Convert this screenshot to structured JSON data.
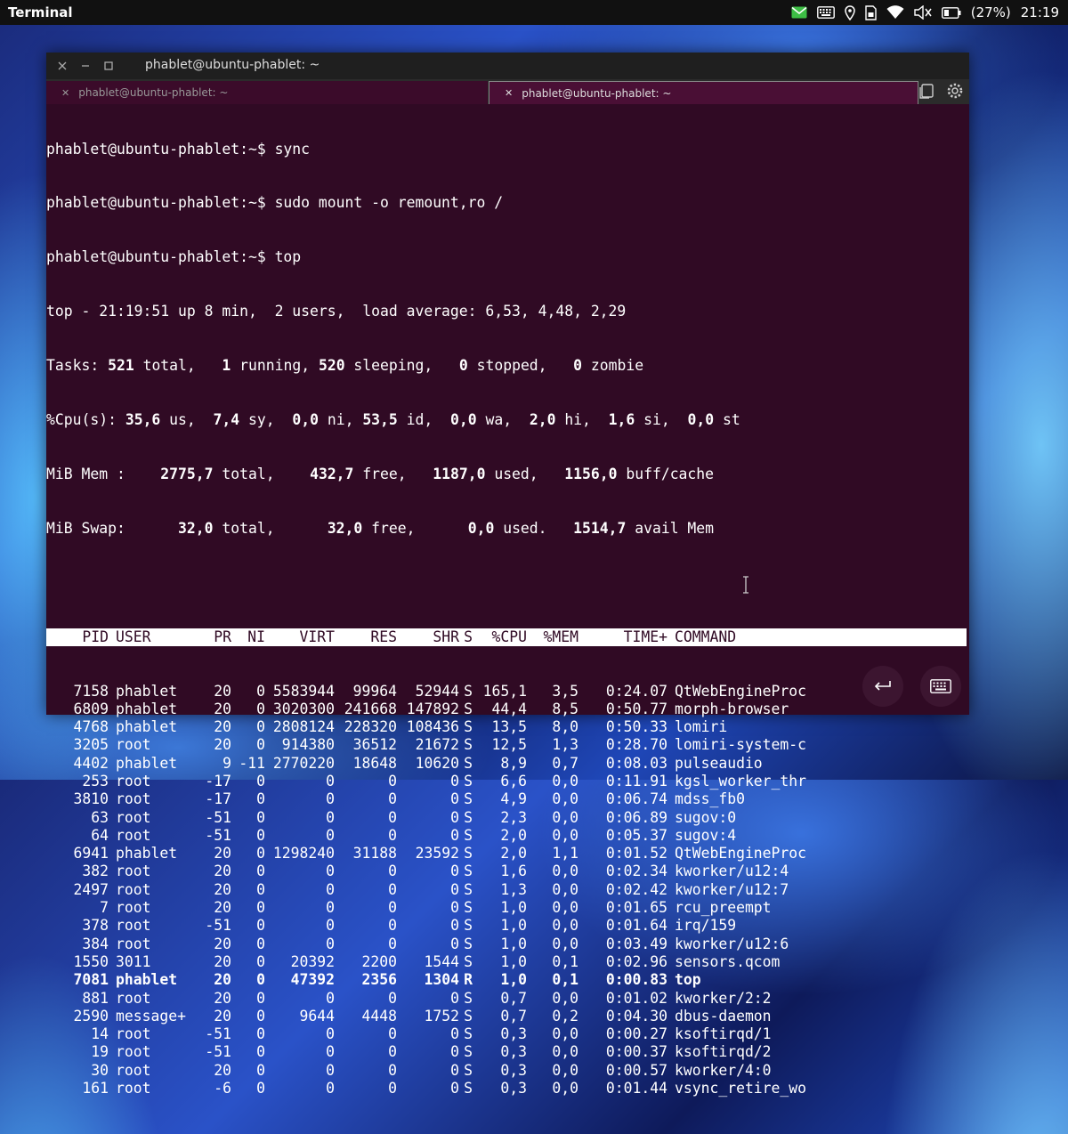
{
  "panel": {
    "title": "Terminal",
    "battery_pct": "(27%)",
    "time": "21:19"
  },
  "window": {
    "title": "phablet@ubuntu-phablet: ~",
    "tabs": [
      {
        "label": "phablet@ubuntu-phablet: ~",
        "active": false
      },
      {
        "label": "phablet@ubuntu-phablet: ~",
        "active": true
      }
    ]
  },
  "terminal": {
    "commands": [
      "phablet@ubuntu-phablet:~$ sync",
      "phablet@ubuntu-phablet:~$ sudo mount -o remount,ro /",
      "phablet@ubuntu-phablet:~$ top"
    ],
    "summary": {
      "uptime_line": "top - 21:19:51 up 8 min,  2 users,  load average: 6,53, 4,48, 2,29",
      "tasks": {
        "label": "Tasks:",
        "total": "521",
        "running": "1",
        "sleeping": "520",
        "stopped": "0",
        "zombie": "0"
      },
      "cpu": {
        "label": "%Cpu(s):",
        "us": "35,6",
        "sy": "7,4",
        "ni": "0,0",
        "id": "53,5",
        "wa": "0,0",
        "hi": "2,0",
        "si": "1,6",
        "st": "0,0"
      },
      "mem": {
        "label": "MiB Mem :",
        "total": "2775,7",
        "free": "432,7",
        "used": "1187,0",
        "buff": "1156,0"
      },
      "swap": {
        "label": "MiB Swap:",
        "total": "32,0",
        "free": "32,0",
        "used": "0,0",
        "avail": "1514,7"
      }
    },
    "columns": [
      "PID",
      "USER",
      "PR",
      "NI",
      "VIRT",
      "RES",
      "SHR",
      "S",
      "%CPU",
      "%MEM",
      "TIME+",
      "COMMAND"
    ],
    "processes": [
      {
        "pid": "7158",
        "user": "phablet",
        "pr": "20",
        "ni": "0",
        "virt": "5583944",
        "res": "99964",
        "shr": "52944",
        "s": "S",
        "cpu": "165,1",
        "mem": "3,5",
        "time": "0:24.07",
        "cmd": "QtWebEngineProc",
        "bold": false
      },
      {
        "pid": "6809",
        "user": "phablet",
        "pr": "20",
        "ni": "0",
        "virt": "3020300",
        "res": "241668",
        "shr": "147892",
        "s": "S",
        "cpu": "44,4",
        "mem": "8,5",
        "time": "0:50.77",
        "cmd": "morph-browser",
        "bold": false
      },
      {
        "pid": "4768",
        "user": "phablet",
        "pr": "20",
        "ni": "0",
        "virt": "2808124",
        "res": "228320",
        "shr": "108436",
        "s": "S",
        "cpu": "13,5",
        "mem": "8,0",
        "time": "0:50.33",
        "cmd": "lomiri",
        "bold": false
      },
      {
        "pid": "3205",
        "user": "root",
        "pr": "20",
        "ni": "0",
        "virt": "914380",
        "res": "36512",
        "shr": "21672",
        "s": "S",
        "cpu": "12,5",
        "mem": "1,3",
        "time": "0:28.70",
        "cmd": "lomiri-system-c",
        "bold": false
      },
      {
        "pid": "4402",
        "user": "phablet",
        "pr": "9",
        "ni": "-11",
        "virt": "2770220",
        "res": "18648",
        "shr": "10620",
        "s": "S",
        "cpu": "8,9",
        "mem": "0,7",
        "time": "0:08.03",
        "cmd": "pulseaudio",
        "bold": false
      },
      {
        "pid": "253",
        "user": "root",
        "pr": "-17",
        "ni": "0",
        "virt": "0",
        "res": "0",
        "shr": "0",
        "s": "S",
        "cpu": "6,6",
        "mem": "0,0",
        "time": "0:11.91",
        "cmd": "kgsl_worker_thr",
        "bold": false
      },
      {
        "pid": "3810",
        "user": "root",
        "pr": "-17",
        "ni": "0",
        "virt": "0",
        "res": "0",
        "shr": "0",
        "s": "S",
        "cpu": "4,9",
        "mem": "0,0",
        "time": "0:06.74",
        "cmd": "mdss_fb0",
        "bold": false
      },
      {
        "pid": "63",
        "user": "root",
        "pr": "-51",
        "ni": "0",
        "virt": "0",
        "res": "0",
        "shr": "0",
        "s": "S",
        "cpu": "2,3",
        "mem": "0,0",
        "time": "0:06.89",
        "cmd": "sugov:0",
        "bold": false
      },
      {
        "pid": "64",
        "user": "root",
        "pr": "-51",
        "ni": "0",
        "virt": "0",
        "res": "0",
        "shr": "0",
        "s": "S",
        "cpu": "2,0",
        "mem": "0,0",
        "time": "0:05.37",
        "cmd": "sugov:4",
        "bold": false
      },
      {
        "pid": "6941",
        "user": "phablet",
        "pr": "20",
        "ni": "0",
        "virt": "1298240",
        "res": "31188",
        "shr": "23592",
        "s": "S",
        "cpu": "2,0",
        "mem": "1,1",
        "time": "0:01.52",
        "cmd": "QtWebEngineProc",
        "bold": false
      },
      {
        "pid": "382",
        "user": "root",
        "pr": "20",
        "ni": "0",
        "virt": "0",
        "res": "0",
        "shr": "0",
        "s": "S",
        "cpu": "1,6",
        "mem": "0,0",
        "time": "0:02.34",
        "cmd": "kworker/u12:4",
        "bold": false
      },
      {
        "pid": "2497",
        "user": "root",
        "pr": "20",
        "ni": "0",
        "virt": "0",
        "res": "0",
        "shr": "0",
        "s": "S",
        "cpu": "1,3",
        "mem": "0,0",
        "time": "0:02.42",
        "cmd": "kworker/u12:7",
        "bold": false
      },
      {
        "pid": "7",
        "user": "root",
        "pr": "20",
        "ni": "0",
        "virt": "0",
        "res": "0",
        "shr": "0",
        "s": "S",
        "cpu": "1,0",
        "mem": "0,0",
        "time": "0:01.65",
        "cmd": "rcu_preempt",
        "bold": false
      },
      {
        "pid": "378",
        "user": "root",
        "pr": "-51",
        "ni": "0",
        "virt": "0",
        "res": "0",
        "shr": "0",
        "s": "S",
        "cpu": "1,0",
        "mem": "0,0",
        "time": "0:01.64",
        "cmd": "irq/159",
        "bold": false
      },
      {
        "pid": "384",
        "user": "root",
        "pr": "20",
        "ni": "0",
        "virt": "0",
        "res": "0",
        "shr": "0",
        "s": "S",
        "cpu": "1,0",
        "mem": "0,0",
        "time": "0:03.49",
        "cmd": "kworker/u12:6",
        "bold": false
      },
      {
        "pid": "1550",
        "user": "3011",
        "pr": "20",
        "ni": "0",
        "virt": "20392",
        "res": "2200",
        "shr": "1544",
        "s": "S",
        "cpu": "1,0",
        "mem": "0,1",
        "time": "0:02.96",
        "cmd": "sensors.qcom",
        "bold": false
      },
      {
        "pid": "7081",
        "user": "phablet",
        "pr": "20",
        "ni": "0",
        "virt": "47392",
        "res": "2356",
        "shr": "1304",
        "s": "R",
        "cpu": "1,0",
        "mem": "0,1",
        "time": "0:00.83",
        "cmd": "top",
        "bold": true
      },
      {
        "pid": "881",
        "user": "root",
        "pr": "20",
        "ni": "0",
        "virt": "0",
        "res": "0",
        "shr": "0",
        "s": "S",
        "cpu": "0,7",
        "mem": "0,0",
        "time": "0:01.02",
        "cmd": "kworker/2:2",
        "bold": false
      },
      {
        "pid": "2590",
        "user": "message+",
        "pr": "20",
        "ni": "0",
        "virt": "9644",
        "res": "4448",
        "shr": "1752",
        "s": "S",
        "cpu": "0,7",
        "mem": "0,2",
        "time": "0:04.30",
        "cmd": "dbus-daemon",
        "bold": false
      },
      {
        "pid": "14",
        "user": "root",
        "pr": "-51",
        "ni": "0",
        "virt": "0",
        "res": "0",
        "shr": "0",
        "s": "S",
        "cpu": "0,3",
        "mem": "0,0",
        "time": "0:00.27",
        "cmd": "ksoftirqd/1",
        "bold": false
      },
      {
        "pid": "19",
        "user": "root",
        "pr": "-51",
        "ni": "0",
        "virt": "0",
        "res": "0",
        "shr": "0",
        "s": "S",
        "cpu": "0,3",
        "mem": "0,0",
        "time": "0:00.37",
        "cmd": "ksoftirqd/2",
        "bold": false
      },
      {
        "pid": "30",
        "user": "root",
        "pr": "20",
        "ni": "0",
        "virt": "0",
        "res": "0",
        "shr": "0",
        "s": "S",
        "cpu": "0,3",
        "mem": "0,0",
        "time": "0:00.57",
        "cmd": "kworker/4:0",
        "bold": false
      },
      {
        "pid": "161",
        "user": "root",
        "pr": "-6",
        "ni": "0",
        "virt": "0",
        "res": "0",
        "shr": "0",
        "s": "S",
        "cpu": "0,3",
        "mem": "0,0",
        "time": "0:01.44",
        "cmd": "vsync_retire_wo",
        "bold": false
      }
    ]
  },
  "colors": {
    "terminal_bg": "#300a24",
    "panel_bg": "#111111",
    "header_bg": "#ffffff",
    "mail_icon": "#3dbe45"
  }
}
